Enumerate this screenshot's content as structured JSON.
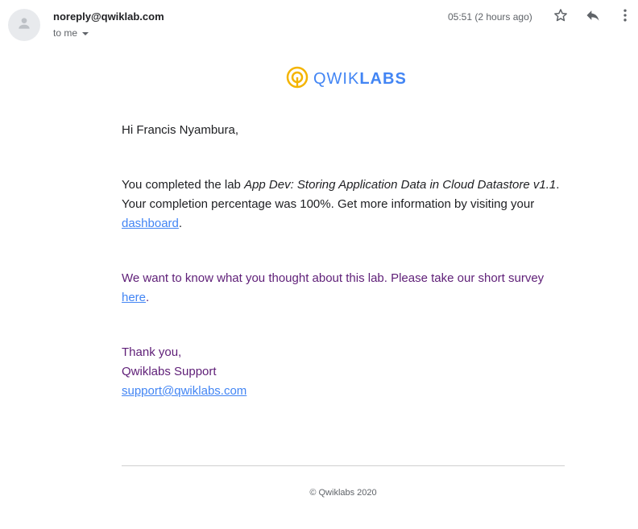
{
  "header": {
    "sender": "noreply@qwiklab.com",
    "recipient": "to me",
    "time": "05:51 (2 hours ago)",
    "icons": [
      "person-icon",
      "star-icon",
      "reply-icon",
      "more-vert-icon"
    ]
  },
  "logo": {
    "part1": "QWIK",
    "part2": "LABS",
    "icon_color": "#f4b400",
    "text_color": "#4285f4"
  },
  "body": {
    "greeting": "Hi Francis Nyambura,",
    "lab_intro": "You completed the lab ",
    "lab_name": "App Dev: Storing Application Data in Cloud Datastore v1.1",
    "lab_result": ". Your completion percentage was 100%. Get more information by visiting your ",
    "dashboard_link": "dashboard",
    "lab_end": ".",
    "survey_text": "We want to know what you thought about this lab. Please take our short survey ",
    "survey_link": "here",
    "survey_end": ".",
    "thanks": "Thank you,",
    "signature": "Qwiklabs Support",
    "support_email": "support@qwiklabs.com"
  },
  "footer": {
    "copyright": "© Qwiklabs 2020"
  },
  "colors": {
    "link": "#4285f4",
    "survey_text": "#5e1e77",
    "logo_accent": "#f4b400"
  }
}
